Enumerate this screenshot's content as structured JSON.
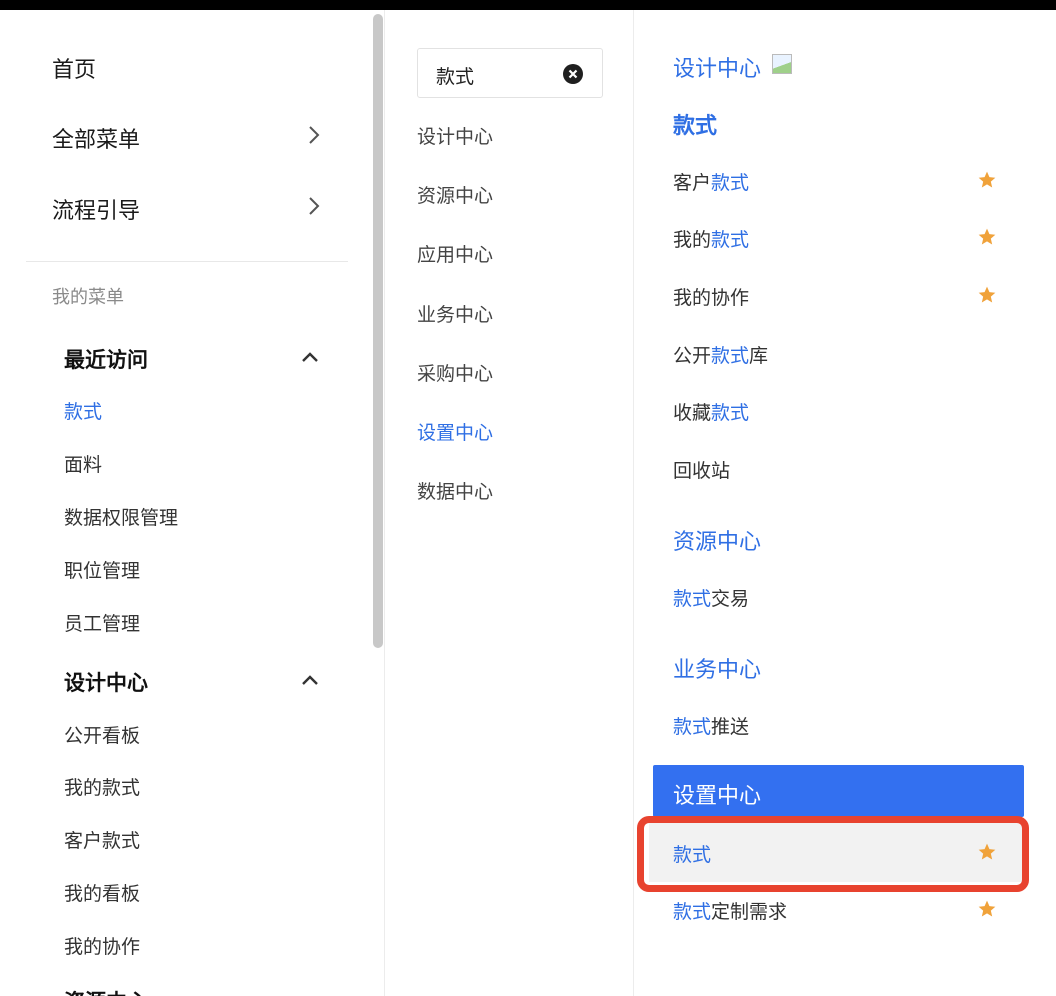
{
  "left_nav": {
    "top_items": [
      {
        "label": "首页"
      },
      {
        "label": "全部菜单"
      },
      {
        "label": "流程引导"
      }
    ],
    "section_label": "我的菜单",
    "groups": [
      {
        "title": "最近访问",
        "items": [
          "款式",
          "面料",
          "数据权限管理",
          "职位管理",
          "员工管理"
        ]
      },
      {
        "title": "设计中心",
        "items": [
          "公开看板",
          "我的款式",
          "客户款式",
          "我的看板",
          "我的协作"
        ]
      },
      {
        "title": "资源中心"
      }
    ]
  },
  "search": {
    "value": "款式"
  },
  "categories": [
    "设计中心",
    "资源中心",
    "应用中心",
    "业务中心",
    "采购中心",
    "设置中心",
    "数据中心"
  ],
  "active_category": "设置中心",
  "results": {
    "design": {
      "title": "设计中心",
      "subtitle": "款式",
      "items": [
        {
          "pre": "客户",
          "hl": "款式",
          "post": ""
        },
        {
          "pre": "我的",
          "hl": "款式",
          "post": ""
        },
        {
          "pre": "我的协作",
          "hl": "",
          "post": ""
        },
        {
          "pre": "公开",
          "hl": "款式",
          "post": "库"
        },
        {
          "pre": "收藏",
          "hl": "款式",
          "post": ""
        },
        {
          "pre": "回收站",
          "hl": "",
          "post": ""
        }
      ]
    },
    "resource": {
      "title": "资源中心",
      "items": [
        {
          "pre": "",
          "hl": "款式",
          "post": "交易"
        }
      ]
    },
    "business": {
      "title": "业务中心",
      "items": [
        {
          "pre": "",
          "hl": "款式",
          "post": "推送"
        }
      ]
    },
    "settings": {
      "title": "设置中心",
      "items": [
        {
          "pre": "",
          "hl": "款式",
          "post": ""
        },
        {
          "pre": "",
          "hl": "款式",
          "post": "定制需求"
        }
      ]
    }
  },
  "colors": {
    "accent": "#2f6fe4",
    "star": "#f0a23a",
    "highlight_box": "#e8432f",
    "settings_bar": "#3370f0"
  },
  "icons": {
    "star": "star-icon",
    "clear": "close-circle-icon",
    "expand": "chevron-right-icon",
    "collapse": "chevron-up-icon"
  }
}
